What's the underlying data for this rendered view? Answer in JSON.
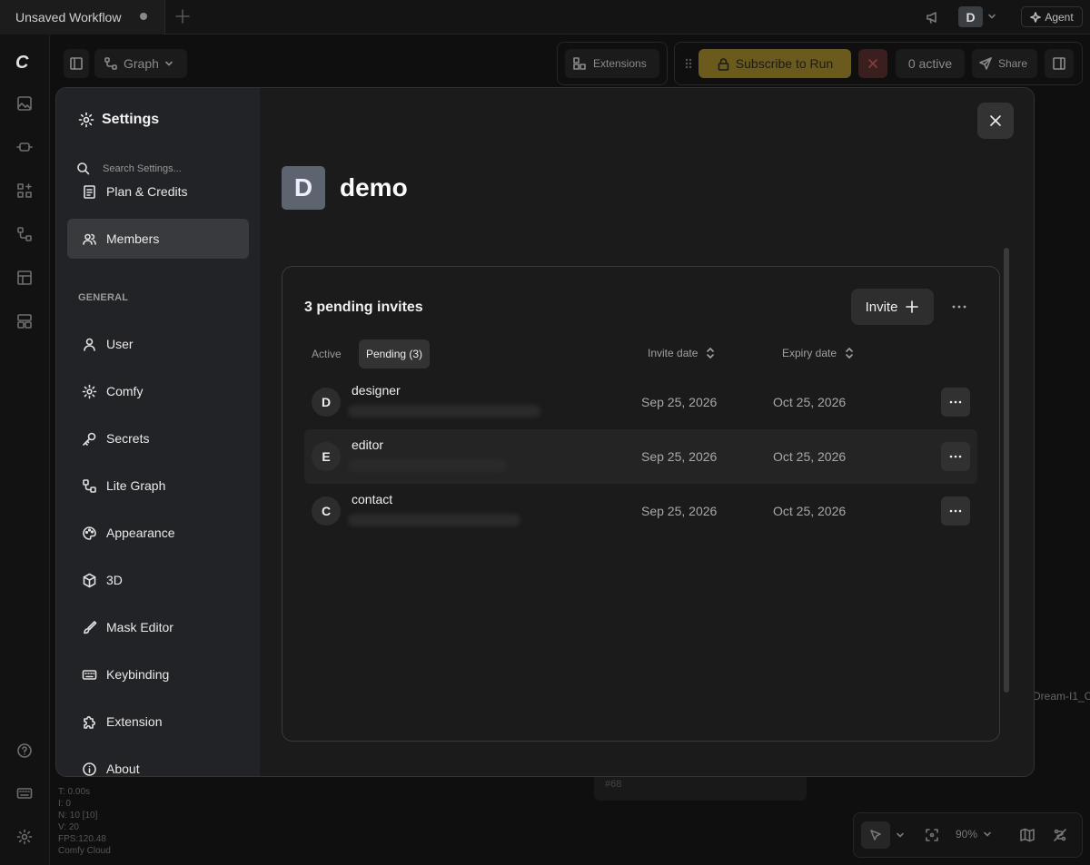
{
  "window": {
    "tab_title": "Unsaved Workflow",
    "user_initial": "D",
    "agent_label": "Agent"
  },
  "canvas_toolbar": {
    "graph_label": "Graph",
    "extensions_label": "Extensions",
    "subscribe_label": "Subscribe to Run",
    "active_label": "0 active",
    "share_label": "Share"
  },
  "stats": {
    "lines": [
      "T: 0.00s",
      "I: 0",
      "N: 10 [10]",
      "V: 20",
      "FPS:120.48",
      "Comfy Cloud"
    ]
  },
  "canvas": {
    "node_id": "#68",
    "side_text": "Dream-I1_C"
  },
  "bottom_tools": {
    "zoom": "90%"
  },
  "settings": {
    "title": "Settings",
    "search_placeholder": "Search Settings...",
    "top_items": [
      {
        "label": "Plan & Credits",
        "icon": "document-icon"
      },
      {
        "label": "Members",
        "icon": "users-icon",
        "active": true
      }
    ],
    "group_label": "GENERAL",
    "general_items": [
      {
        "label": "User",
        "icon": "user-icon"
      },
      {
        "label": "Comfy",
        "icon": "gear-icon"
      },
      {
        "label": "Secrets",
        "icon": "key-icon"
      },
      {
        "label": "Lite Graph",
        "icon": "graph-icon"
      },
      {
        "label": "Appearance",
        "icon": "palette-icon"
      },
      {
        "label": "3D",
        "icon": "cube-icon"
      },
      {
        "label": "Mask Editor",
        "icon": "brush-icon"
      },
      {
        "label": "Keybinding",
        "icon": "keyboard-icon"
      },
      {
        "label": "Extension",
        "icon": "puzzle-icon"
      },
      {
        "label": "About",
        "icon": "info-icon"
      }
    ]
  },
  "workspace": {
    "initial": "D",
    "name": "demo"
  },
  "members": {
    "heading": "3 pending invites",
    "invite_label": "Invite",
    "tabs": [
      {
        "label": "Active"
      },
      {
        "label": "Pending (3)",
        "selected": true
      }
    ],
    "columns": {
      "invite_date": "Invite date",
      "expiry_date": "Expiry date"
    },
    "invites": [
      {
        "initial": "D",
        "name": "designer",
        "invite_date": "Sep 25, 2026",
        "expiry_date": "Oct 25, 2026"
      },
      {
        "initial": "E",
        "name": "editor",
        "invite_date": "Sep 25, 2026",
        "expiry_date": "Oct 25, 2026"
      },
      {
        "initial": "C",
        "name": "contact",
        "invite_date": "Sep 25, 2026",
        "expiry_date": "Oct 25, 2026"
      }
    ]
  },
  "colors": {
    "accent_subscribe": "#6a5a1d",
    "active_nav": "#393a3e",
    "modal_bg": "#1b1b1b"
  }
}
